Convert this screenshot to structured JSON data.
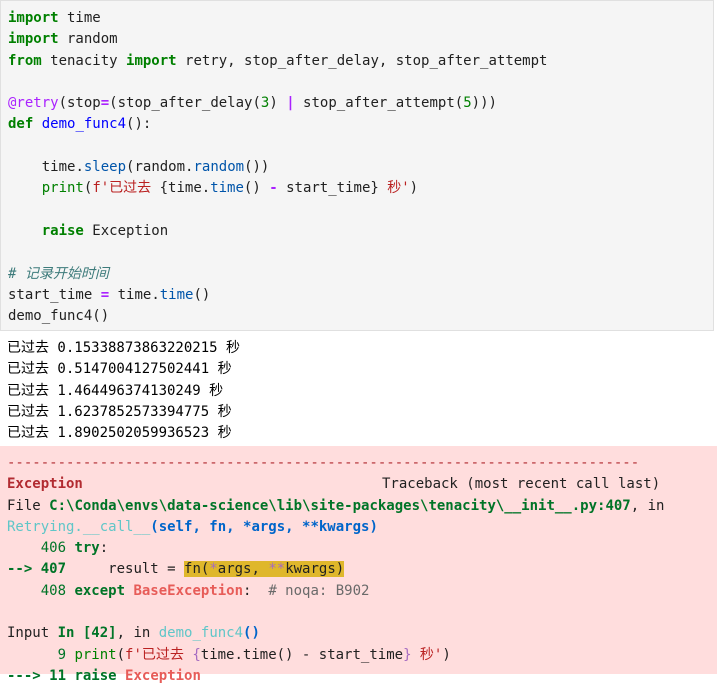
{
  "input_cell": {
    "lines": [
      {
        "tokens": [
          {
            "t": "import",
            "c": "kw"
          },
          {
            "t": " time",
            "c": ""
          }
        ]
      },
      {
        "tokens": [
          {
            "t": "import",
            "c": "kw"
          },
          {
            "t": " random",
            "c": ""
          }
        ]
      },
      {
        "tokens": [
          {
            "t": "from",
            "c": "kw"
          },
          {
            "t": " tenacity ",
            "c": ""
          },
          {
            "t": "import",
            "c": "kw"
          },
          {
            "t": " retry, stop_after_delay, stop_after_attempt",
            "c": ""
          }
        ]
      },
      {
        "tokens": []
      },
      {
        "tokens": [
          {
            "t": "@retry",
            "c": "dec"
          },
          {
            "t": "(stop",
            "c": ""
          },
          {
            "t": "=",
            "c": "op"
          },
          {
            "t": "(stop_after_delay(",
            "c": ""
          },
          {
            "t": "3",
            "c": "num"
          },
          {
            "t": ") ",
            "c": ""
          },
          {
            "t": "|",
            "c": "op"
          },
          {
            "t": " stop_after_attempt(",
            "c": ""
          },
          {
            "t": "5",
            "c": "num"
          },
          {
            "t": ")))",
            "c": ""
          }
        ]
      },
      {
        "tokens": [
          {
            "t": "def",
            "c": "kw"
          },
          {
            "t": " ",
            "c": ""
          },
          {
            "t": "demo_func4",
            "c": "fn"
          },
          {
            "t": "():",
            "c": ""
          }
        ]
      },
      {
        "tokens": []
      },
      {
        "tokens": [
          {
            "t": "    time",
            "c": ""
          },
          {
            "t": ".",
            "c": ""
          },
          {
            "t": "sleep",
            "c": "attr"
          },
          {
            "t": "(random",
            "c": ""
          },
          {
            "t": ".",
            "c": ""
          },
          {
            "t": "random",
            "c": "attr"
          },
          {
            "t": "())",
            "c": ""
          }
        ]
      },
      {
        "tokens": [
          {
            "t": "    ",
            "c": ""
          },
          {
            "t": "print",
            "c": "bi"
          },
          {
            "t": "(",
            "c": ""
          },
          {
            "t": "f'已过去 ",
            "c": "str"
          },
          {
            "t": "{time",
            "c": ""
          },
          {
            "t": ".",
            "c": ""
          },
          {
            "t": "time",
            "c": "attr"
          },
          {
            "t": "() ",
            "c": ""
          },
          {
            "t": "-",
            "c": "op"
          },
          {
            "t": " start_time}",
            "c": ""
          },
          {
            "t": " 秒'",
            "c": "str"
          },
          {
            "t": ")",
            "c": ""
          }
        ]
      },
      {
        "tokens": []
      },
      {
        "tokens": [
          {
            "t": "    ",
            "c": ""
          },
          {
            "t": "raise",
            "c": "kw"
          },
          {
            "t": " Exception",
            "c": ""
          }
        ]
      },
      {
        "tokens": []
      },
      {
        "tokens": [
          {
            "t": "# 记录开始时间",
            "c": "cm"
          }
        ]
      },
      {
        "tokens": [
          {
            "t": "start_time ",
            "c": ""
          },
          {
            "t": "=",
            "c": "op"
          },
          {
            "t": " time",
            "c": ""
          },
          {
            "t": ".",
            "c": ""
          },
          {
            "t": "time",
            "c": "attr"
          },
          {
            "t": "()",
            "c": ""
          }
        ]
      },
      {
        "tokens": [
          {
            "t": "demo_func4()",
            "c": ""
          }
        ]
      }
    ]
  },
  "stdout": {
    "prefix": "已过去",
    "suffix": "秒",
    "values": [
      "0.15338873863220215",
      "0.5147004127502441",
      "1.464496374130249",
      "1.6237852573394775",
      "1.8902502059936523"
    ]
  },
  "stderr": {
    "separator": "---------------------------------------------------------------------------",
    "exception_name": "Exception",
    "traceback_header": "Traceback (most recent call last)",
    "file_prefix": "File ",
    "file_path": "C:\\Conda\\envs\\data-science\\lib\\site-packages\\tenacity\\__init__.py:407",
    "file_suffix": ", in",
    "func_name": "Retrying.__call__",
    "func_args": "(self, fn, *args, **kwargs)",
    "frame1": [
      {
        "num": "406",
        "arrow": "",
        "code": [
          {
            "t": "try",
            "c": "grn-b"
          },
          {
            "t": ":",
            "c": ""
          }
        ]
      },
      {
        "num": "407",
        "arrow": "--> ",
        "code": [
          {
            "t": "    result ",
            "c": ""
          },
          {
            "t": "=",
            "c": ""
          },
          {
            "t": " ",
            "c": ""
          },
          {
            "t": "fn(",
            "c": "hl"
          },
          {
            "t": "*",
            "c": "hl hlstar"
          },
          {
            "t": "args, ",
            "c": "hl"
          },
          {
            "t": "**",
            "c": "hl hlstar"
          },
          {
            "t": "kwargs)",
            "c": "hl"
          }
        ]
      },
      {
        "num": "408",
        "arrow": "",
        "code": [
          {
            "t": "except",
            "c": "grn-b"
          },
          {
            "t": " ",
            "c": ""
          },
          {
            "t": "BaseException",
            "c": "exc"
          },
          {
            "t": ":  ",
            "c": ""
          },
          {
            "t": "# noqa: B902",
            "c": "gray"
          }
        ]
      }
    ],
    "input_prefix": "Input ",
    "input_cell_label": "In [42]",
    "input_mid": ", in ",
    "input_func": "demo_func4",
    "input_parens": "()",
    "frame2": [
      {
        "num": "9",
        "arrow": "",
        "code": [
          {
            "t": "print",
            "c": "bi"
          },
          {
            "t": "(",
            "c": ""
          },
          {
            "t": "f'已过去 ",
            "c": "str"
          },
          {
            "t": "{",
            "c": "hlstar"
          },
          {
            "t": "time.time() - start_time",
            "c": ""
          },
          {
            "t": "}",
            "c": "hlstar"
          },
          {
            "t": " 秒'",
            "c": "str"
          },
          {
            "t": ")",
            "c": ""
          }
        ]
      },
      {
        "num": "11",
        "arrow": "---> ",
        "code": [
          {
            "t": "raise",
            "c": "grn-b"
          },
          {
            "t": " ",
            "c": ""
          },
          {
            "t": "Exception",
            "c": "exc"
          }
        ]
      }
    ]
  }
}
